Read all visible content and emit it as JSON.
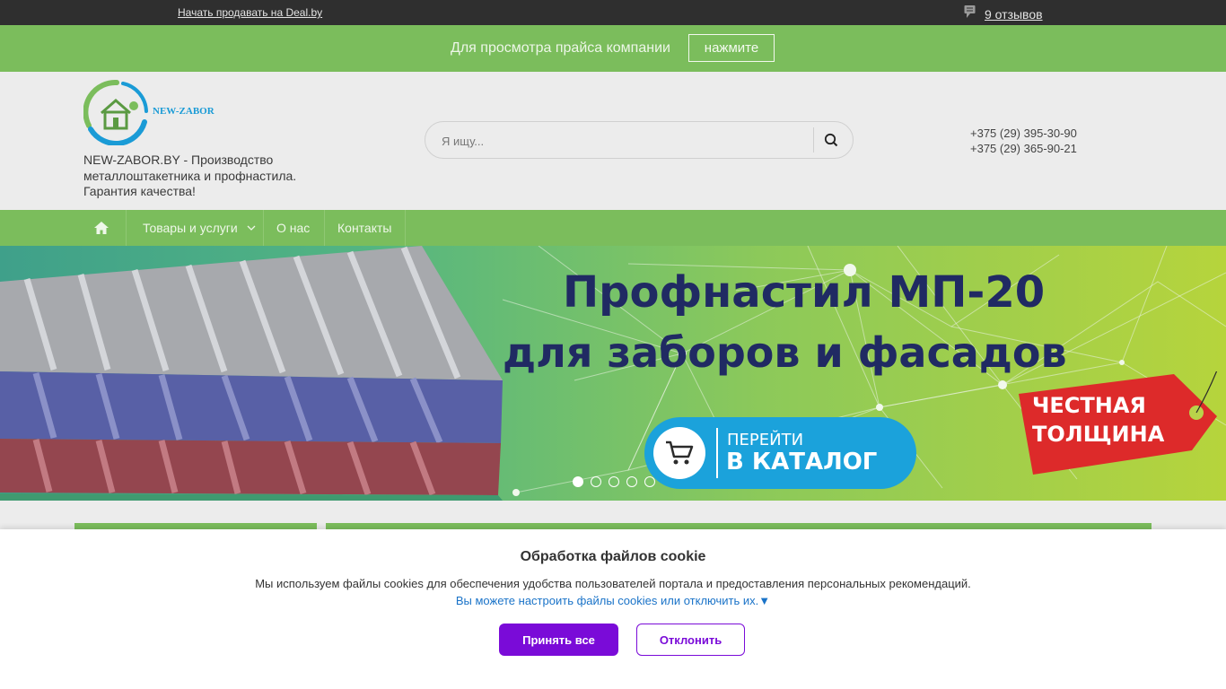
{
  "topbar": {
    "sell_link": "Начать продавать на Deal.by",
    "reviews_label": "9 отзывов",
    "reviews_icon": "comment-icon"
  },
  "price_bar": {
    "text": "Для просмотра прайса компании",
    "button_label": "нажмите"
  },
  "header": {
    "logo_text": "NEW-ZABOR",
    "tagline": "NEW-ZABOR.BY - Производство металлоштакетника и профнастила. Гарантия качества!",
    "search_placeholder": "Я ищу...",
    "phones": [
      "+375 (29) 395-30-90",
      "+375 (29) 365-90-21"
    ]
  },
  "nav": {
    "home_icon": "home-icon",
    "items": [
      "Товары и услуги",
      "О нас",
      "Контакты"
    ]
  },
  "banner": {
    "title_line1": "Профнастил МП-20",
    "title_line2": "для заборов и фасадов",
    "button_line1": "ПЕРЕЙТИ",
    "button_line2": "В КАТАЛОГ",
    "tag_line1": "ЧЕСТНАЯ",
    "tag_line2": "ТОЛЩИНА",
    "slides_count": 5,
    "active_slide": 1
  },
  "cookie": {
    "title": "Обработка файлов cookie",
    "text": "Мы используем файлы cookies для обеспечения удобства пользователей портала и предоставления персональных рекомендаций.",
    "settings_link": "Вы можете настроить файлы cookies или отключить их.▼",
    "accept_label": "Принять все",
    "decline_label": "Отклонить"
  },
  "colors": {
    "accent_green": "#7bbd5c",
    "topbar": "#2f2f2f",
    "cookie_button": "#7a0bd8",
    "banner_title": "#202a63"
  }
}
